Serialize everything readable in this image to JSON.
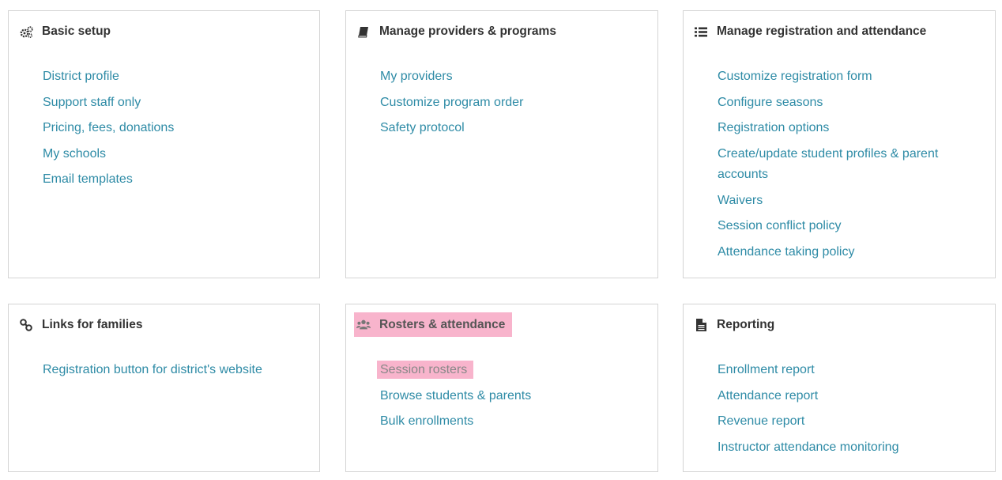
{
  "cards": [
    {
      "title": "Basic setup",
      "icon": "gears-icon",
      "links": [
        "District profile",
        "Support staff only",
        "Pricing, fees, donations",
        "My schools",
        "Email templates"
      ]
    },
    {
      "title": "Manage providers & programs",
      "icon": "book-icon",
      "links": [
        "My providers",
        "Customize program order",
        "Safety protocol"
      ]
    },
    {
      "title": "Manage registration and attendance",
      "icon": "list-icon",
      "links": [
        "Customize registration form",
        "Configure seasons",
        "Registration options",
        "Create/update student profiles & parent accounts",
        "Waivers",
        "Session conflict policy",
        "Attendance taking policy"
      ]
    },
    {
      "title": "Links for families",
      "icon": "link-icon",
      "links": [
        "Registration button for district's website"
      ]
    },
    {
      "title": "Rosters & attendance",
      "icon": "users-icon",
      "links": [
        "Session rosters",
        "Browse students & parents",
        "Bulk enrollments"
      ]
    },
    {
      "title": "Reporting",
      "icon": "document-icon",
      "links": [
        "Enrollment report",
        "Attendance report",
        "Revenue report",
        "Instructor attendance monitoring"
      ]
    }
  ],
  "colors": {
    "link": "#2e8ba6",
    "heading": "#333333",
    "highlight": "#f8b4cc",
    "border": "#d4d4d4"
  }
}
